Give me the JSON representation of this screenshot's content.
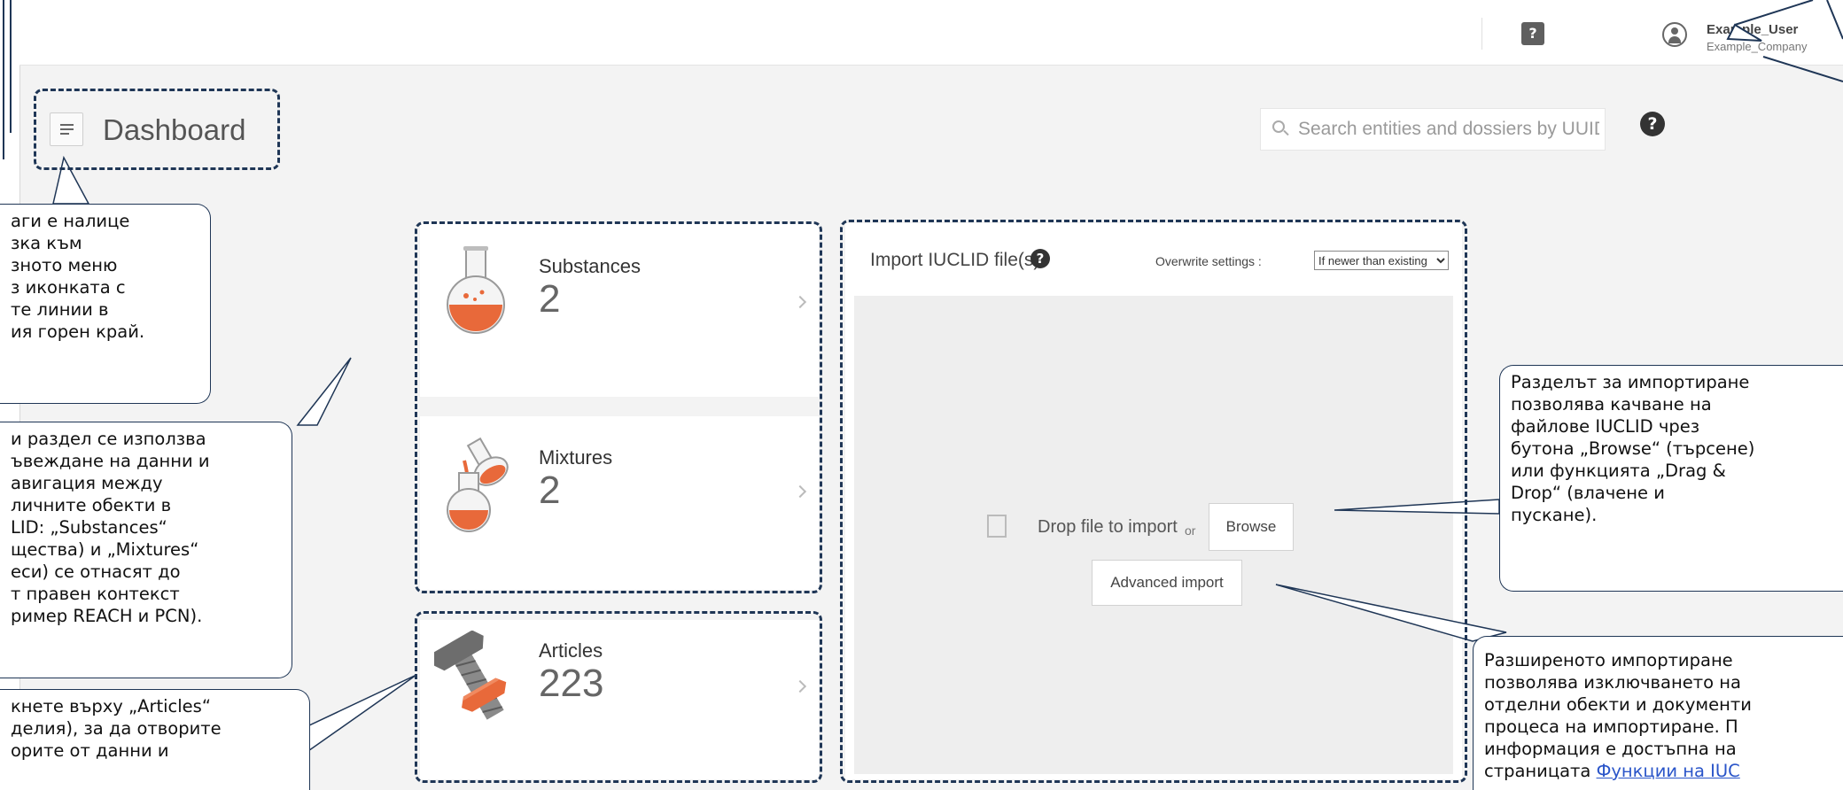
{
  "header": {
    "help_icon": "help-chat-icon",
    "user_name": "Example_User",
    "company": "Example_Company"
  },
  "subheader": {
    "menu_icon": "hamburger-menu-icon",
    "title": "Dashboard",
    "search_placeholder": "Search entities and dossiers by UUID",
    "help_icon": "question-circle-icon"
  },
  "entities": [
    {
      "label": "Substances",
      "count": "2",
      "icon": "flask-icon"
    },
    {
      "label": "Mixtures",
      "count": "2",
      "icon": "pouring-flask-icon"
    },
    {
      "label": "Articles",
      "count": "223",
      "icon": "bolt-nut-icon"
    }
  ],
  "import_panel": {
    "title": "Import IUCLID file(s)",
    "overwrite_label": "Overwrite settings :",
    "overwrite_value": "If newer than existing",
    "drop_text": "Drop file to import",
    "or_text": "or",
    "browse_label": "Browse",
    "advanced_label": "Advanced import"
  },
  "callouts": {
    "menu": "аги е налице\nзка към\nзното меню\nз иконката с\nте линии в\nия горен край.",
    "entities": "и раздел се използва\nъвеждане на данни и\nавигация между\nличните обекти в\nLID: „Substances“\nщества) и „Mixtures“\nеси) се отнасят до\nт правен контекст\nример REACH и PCN).",
    "articles": "кнете върху „Articles“\nделия), за да отворите\nорите от данни и",
    "import": "Разделът за импортиране\nпозволява качване на\nфайлове IUCLID чрез\nбутона „Browse“ (търсене)\nили функцията „Drag &\nDrop“ (влачене и\nпускане).",
    "advanced": "Разширеното импортиране\nпозволява изключването на\nотделни обекти и документи\nпроцеса на импортиране. П\nинформация е достъпна на\nстраницата ",
    "advanced_link": "Функции на IUC"
  },
  "colors": {
    "overlay_border": "#1f3656",
    "link": "#2a55c9",
    "substance_orange": "#e8693a"
  }
}
